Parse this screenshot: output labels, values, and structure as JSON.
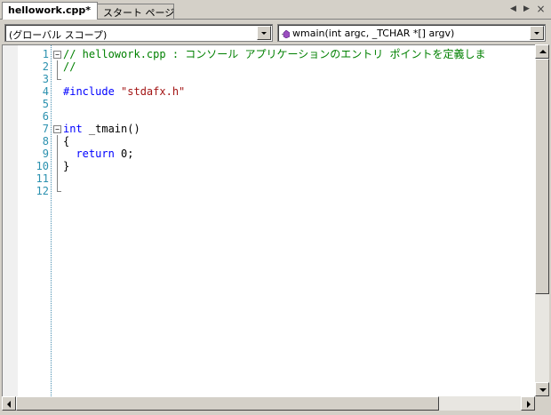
{
  "tabs": [
    {
      "label": "hellowork.cpp*",
      "active": true
    },
    {
      "label": "スタート ページ",
      "active": false
    }
  ],
  "tab_controls": {
    "prev_icon": "triangle-left-icon",
    "next_icon": "triangle-right-icon",
    "close_label": "×"
  },
  "navbar": {
    "scope_value": "(グローバル スコープ)",
    "member_value": "wmain(int argc, _TCHAR *[] argv)",
    "member_icon": "purple-method-icon"
  },
  "editor": {
    "lines": [
      {
        "num": "1",
        "code": "// hellowork.cpp : コンソール アプリケーションのエントリ ポイントを定義しま",
        "kind": "comment",
        "fold": "open"
      },
      {
        "num": "2",
        "code": "//",
        "kind": "comment",
        "fold": "line"
      },
      {
        "num": "3",
        "code": "",
        "kind": "plain",
        "fold": "end"
      },
      {
        "num": "4",
        "code": "#include \"stdafx.h\"",
        "kind": "include",
        "fold": ""
      },
      {
        "num": "5",
        "code": "",
        "kind": "plain",
        "fold": ""
      },
      {
        "num": "6",
        "code": "",
        "kind": "plain",
        "fold": ""
      },
      {
        "num": "7",
        "code": "int _tmain()",
        "kind": "func",
        "fold": "open"
      },
      {
        "num": "8",
        "code": "{",
        "kind": "plain",
        "fold": "line"
      },
      {
        "num": "9",
        "code": "  return 0;",
        "kind": "return",
        "fold": "line"
      },
      {
        "num": "10",
        "code": "}",
        "kind": "plain",
        "fold": "line"
      },
      {
        "num": "11",
        "code": "",
        "kind": "plain",
        "fold": "line"
      },
      {
        "num": "12",
        "code": "",
        "kind": "plain",
        "fold": "end"
      }
    ]
  },
  "colors": {
    "comment": "#008000",
    "keyword": "#0000ff",
    "string": "#a31515",
    "line_number": "#2b91af"
  }
}
